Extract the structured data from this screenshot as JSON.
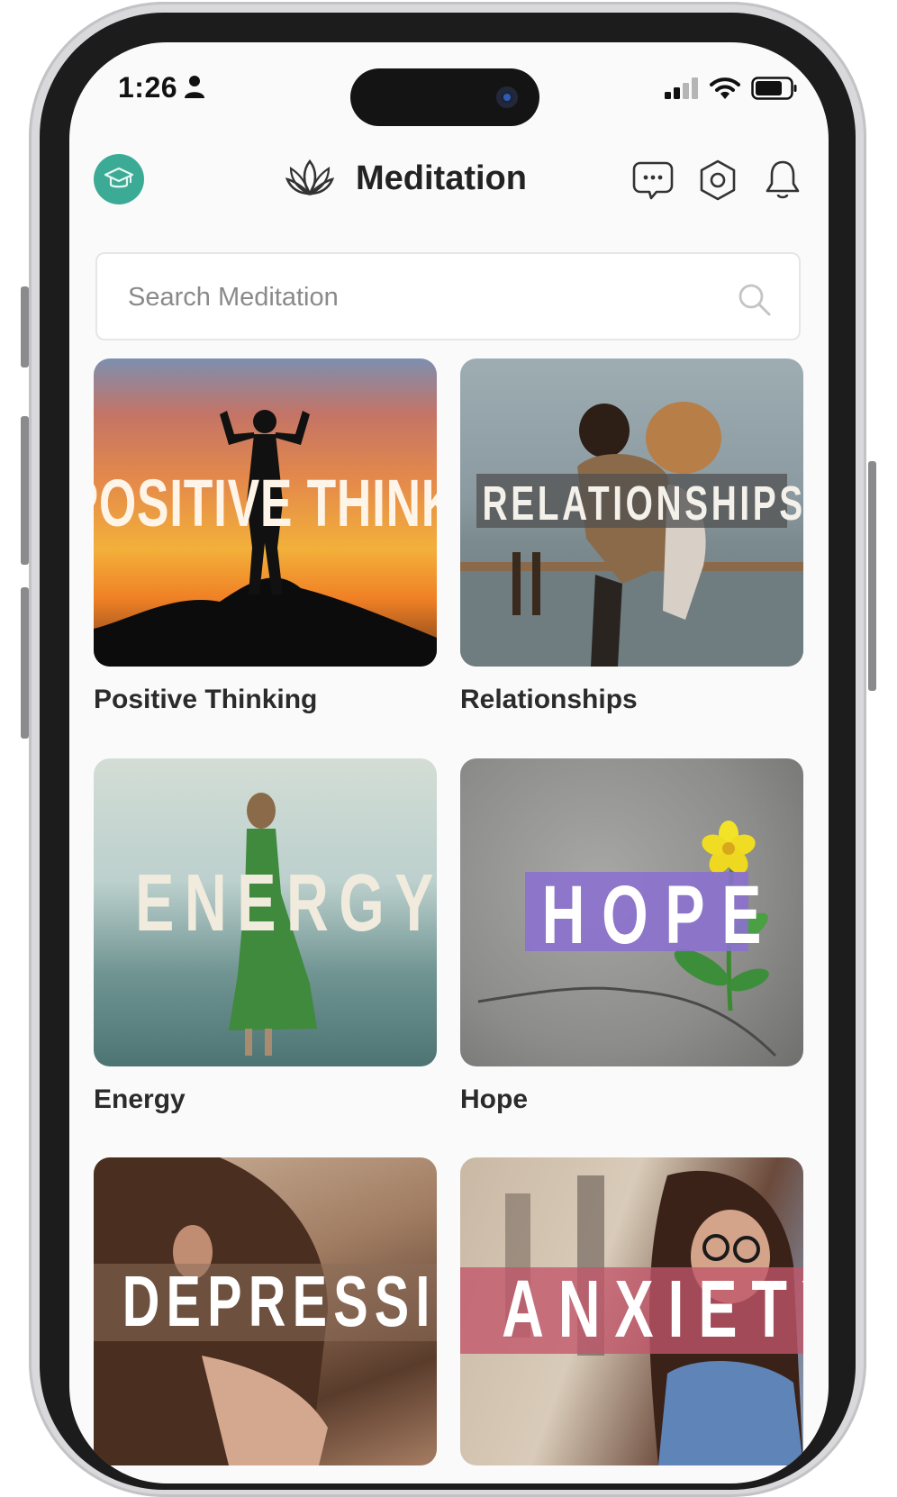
{
  "status_bar": {
    "time": "1:26"
  },
  "header": {
    "title": "Meditation"
  },
  "search": {
    "placeholder": "Search Meditation"
  },
  "categories": [
    {
      "label": "Positive Thinking",
      "banner": "POSITIVE THINKING"
    },
    {
      "label": "Relationships",
      "banner": "RELATIONSHIPS"
    },
    {
      "label": "Energy",
      "banner": "ENERGY"
    },
    {
      "label": "Hope",
      "banner": "HOPE"
    },
    {
      "label": "",
      "banner": "DEPRESSION"
    },
    {
      "label": "",
      "banner": "ANXIETY"
    }
  ],
  "colors": {
    "accent": "#3cab96",
    "hope_banner": "#8b6fd0",
    "anxiety_banner": "#c2566a"
  },
  "icons": [
    "person-icon",
    "signal-icon",
    "wifi-icon",
    "battery-icon",
    "graduation-cap-icon",
    "lotus-icon",
    "chat-icon",
    "settings-icon",
    "bell-icon",
    "search-icon"
  ]
}
